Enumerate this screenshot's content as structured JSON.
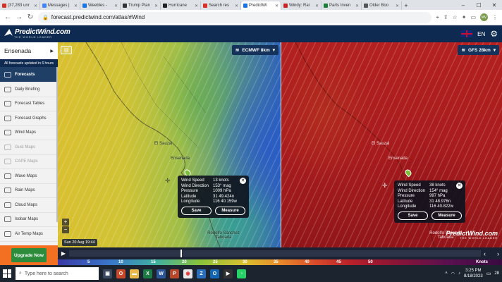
{
  "browser": {
    "tabs": [
      {
        "label": "(37,283 unr",
        "color": "#d93025"
      },
      {
        "label": "Messages |",
        "color": "#4285f4"
      },
      {
        "label": "Weebles -",
        "color": "#1a73e8"
      },
      {
        "label": "Trump Plan",
        "color": "#333333"
      },
      {
        "label": "Hurricane",
        "color": "#222222"
      },
      {
        "label": "Search res",
        "color": "#d93025"
      },
      {
        "label": "PredictWi",
        "color": "#1a73e8",
        "active": true
      },
      {
        "label": "Windy: Rai",
        "color": "#c62828"
      },
      {
        "label": "Parts Inven",
        "color": "#188038"
      },
      {
        "label": "Older Boo",
        "color": "#555555"
      }
    ],
    "url": "forecast.predictwind.com/atlas/#Wind",
    "profile_initials": "MV"
  },
  "app": {
    "logo_main": "PredictWind.com",
    "logo_sub": "THE WORLD LEADER",
    "language": "EN"
  },
  "sidebar": {
    "location": "Ensenada",
    "note": "All forecasts updated in 6 hours",
    "items": [
      {
        "label": "Forecasts",
        "active": true,
        "dim": false
      },
      {
        "label": "Daily Briefing",
        "active": false,
        "dim": false
      },
      {
        "label": "Forecast Tables",
        "active": false,
        "dim": false
      },
      {
        "label": "Forecast Graphs",
        "active": false,
        "dim": false
      },
      {
        "label": "Wind Maps",
        "active": false,
        "dim": false
      },
      {
        "label": "Gust Maps",
        "active": false,
        "dim": true
      },
      {
        "label": "CAPE Maps",
        "active": false,
        "dim": true
      },
      {
        "label": "Wave Maps",
        "active": false,
        "dim": false
      },
      {
        "label": "Rain Maps",
        "active": false,
        "dim": false
      },
      {
        "label": "Cloud Maps",
        "active": false,
        "dim": false
      },
      {
        "label": "Isobar Maps",
        "active": false,
        "dim": false
      },
      {
        "label": "Air Temp Maps",
        "active": false,
        "dim": false
      }
    ],
    "upgrade_label": "Upgrade Now"
  },
  "map_left": {
    "model": "ECMWF 8km",
    "places": [
      "El Sauzal",
      "Ensenada",
      "Rodolfo Sánchez Taboada"
    ],
    "popup": {
      "wind_speed_label": "Wind Speed",
      "wind_speed": "13 knots",
      "wind_direction_label": "Wind Direction",
      "wind_direction": "153° mag",
      "pressure_label": "Pressure",
      "pressure": "1009 hPa",
      "latitude_label": "Latitude",
      "latitude": "31 49.424n",
      "longitude_label": "Longitude",
      "longitude": "116 40.159w",
      "save": "Save",
      "measure": "Measure"
    },
    "date": "Sun 20 Aug 19:44"
  },
  "map_right": {
    "model": "GFS 28km",
    "places": [
      "El Sauzal",
      "Ensenada",
      "Rodolfo Sánchez Taboada"
    ],
    "popup": {
      "wind_speed_label": "Wind Speed",
      "wind_speed": "38 knots",
      "wind_direction_label": "Wind Direction",
      "wind_direction": "154° mag",
      "pressure_label": "Pressure",
      "pressure": "997 hPa",
      "latitude_label": "Latitude",
      "latitude": "31 48.976n",
      "longitude_label": "Longitude",
      "longitude": "116 40.822w",
      "save": "Save",
      "measure": "Measure"
    }
  },
  "legend": {
    "unit": "Knots",
    "ticks": [
      "5",
      "10",
      "15",
      "20",
      "25",
      "30",
      "35",
      "40",
      "45",
      "50"
    ]
  },
  "taskbar": {
    "search_placeholder": "Type here to search",
    "time": "3:25 PM",
    "date": "8/18/2023",
    "badge": "28"
  }
}
